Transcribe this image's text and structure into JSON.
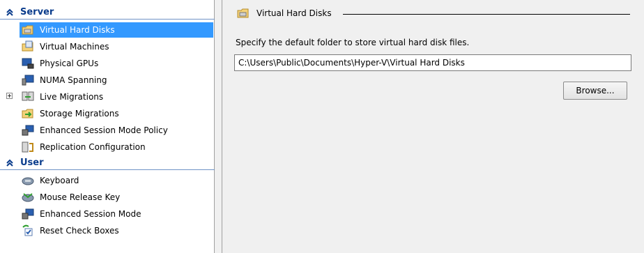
{
  "tree": {
    "server_group": {
      "label": "Server"
    },
    "server_items": [
      {
        "label": "Virtual Hard Disks",
        "icon": "folder-disk-icon",
        "selected": true
      },
      {
        "label": "Virtual Machines",
        "icon": "folder-vm-icon"
      },
      {
        "label": "Physical GPUs",
        "icon": "gpu-monitor-icon"
      },
      {
        "label": "NUMA Spanning",
        "icon": "numa-icon"
      },
      {
        "label": "Live Migrations",
        "icon": "live-migration-icon",
        "expandable": true
      },
      {
        "label": "Storage Migrations",
        "icon": "storage-migration-icon"
      },
      {
        "label": "Enhanced Session Mode Policy",
        "icon": "session-policy-icon"
      },
      {
        "label": "Replication Configuration",
        "icon": "replication-icon"
      }
    ],
    "user_group": {
      "label": "User"
    },
    "user_items": [
      {
        "label": "Keyboard",
        "icon": "keyboard-icon"
      },
      {
        "label": "Mouse Release Key",
        "icon": "mouse-release-icon"
      },
      {
        "label": "Enhanced Session Mode",
        "icon": "session-mode-icon"
      },
      {
        "label": "Reset Check Boxes",
        "icon": "reset-checkbox-icon"
      }
    ]
  },
  "panel": {
    "title": "Virtual Hard Disks",
    "description": "Specify the default folder to store virtual hard disk files.",
    "path_value": "C:\\Users\\Public\\Documents\\Hyper-V\\Virtual Hard Disks",
    "browse_label": "Browse..."
  },
  "colors": {
    "selection": "#3399ff",
    "group_header": "#0a3c8c",
    "group_rule": "#6f93c6"
  }
}
